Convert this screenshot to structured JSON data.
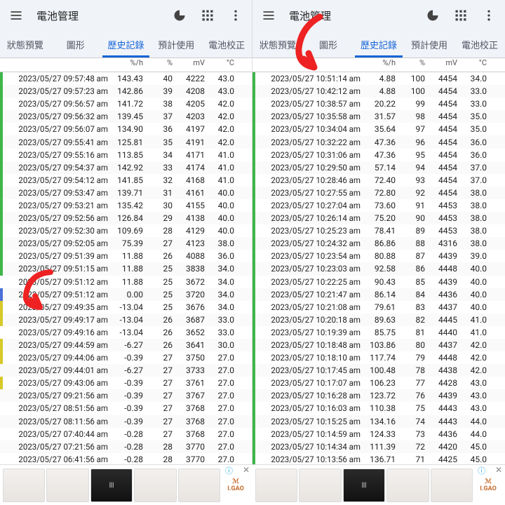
{
  "appbar": {
    "title": "電池管理"
  },
  "tabs": {
    "items": [
      "狀態預覽",
      "圖形",
      "歷史記錄",
      "預計使用",
      "電池校正"
    ],
    "active_index": 2
  },
  "headers": {
    "rate": "%/h",
    "pct": "%",
    "mv": "mV",
    "temp": "°C"
  },
  "left_rows": [
    {
      "c": "g",
      "dt": "2023/05/27 09:57:48 am",
      "rate": "143.43",
      "pct": "40",
      "mv": "4222",
      "temp": "43.0"
    },
    {
      "c": "g",
      "dt": "2023/05/27 09:57:23 am",
      "rate": "142.86",
      "pct": "39",
      "mv": "4208",
      "temp": "43.0"
    },
    {
      "c": "g",
      "dt": "2023/05/27 09:56:57 am",
      "rate": "141.72",
      "pct": "38",
      "mv": "4205",
      "temp": "42.0"
    },
    {
      "c": "g",
      "dt": "2023/05/27 09:56:32 am",
      "rate": "139.45",
      "pct": "37",
      "mv": "4203",
      "temp": "42.0"
    },
    {
      "c": "g",
      "dt": "2023/05/27 09:56:07 am",
      "rate": "134.90",
      "pct": "36",
      "mv": "4197",
      "temp": "42.0"
    },
    {
      "c": "g",
      "dt": "2023/05/27 09:55:41 am",
      "rate": "125.81",
      "pct": "35",
      "mv": "4191",
      "temp": "42.0"
    },
    {
      "c": "g",
      "dt": "2023/05/27 09:55:16 am",
      "rate": "113.85",
      "pct": "34",
      "mv": "4171",
      "temp": "41.0"
    },
    {
      "c": "g",
      "dt": "2023/05/27 09:54:37 am",
      "rate": "142.92",
      "pct": "33",
      "mv": "4174",
      "temp": "41.0"
    },
    {
      "c": "g",
      "dt": "2023/05/27 09:54:12 am",
      "rate": "141.85",
      "pct": "32",
      "mv": "4168",
      "temp": "41.0"
    },
    {
      "c": "g",
      "dt": "2023/05/27 09:53:47 am",
      "rate": "139.71",
      "pct": "31",
      "mv": "4161",
      "temp": "40.0"
    },
    {
      "c": "g",
      "dt": "2023/05/27 09:53:21 am",
      "rate": "135.42",
      "pct": "30",
      "mv": "4155",
      "temp": "40.0"
    },
    {
      "c": "g",
      "dt": "2023/05/27 09:52:56 am",
      "rate": "126.84",
      "pct": "29",
      "mv": "4138",
      "temp": "40.0"
    },
    {
      "c": "g",
      "dt": "2023/05/27 09:52:30 am",
      "rate": "109.69",
      "pct": "28",
      "mv": "4129",
      "temp": "40.0"
    },
    {
      "c": "g",
      "dt": "2023/05/27 09:52:05 am",
      "rate": "75.39",
      "pct": "27",
      "mv": "4123",
      "temp": "38.0"
    },
    {
      "c": "g",
      "dt": "2023/05/27 09:51:39 am",
      "rate": "11.88",
      "pct": "26",
      "mv": "4088",
      "temp": "36.0"
    },
    {
      "c": "g",
      "dt": "2023/05/27 09:51:15 am",
      "rate": "11.88",
      "pct": "25",
      "mv": "3838",
      "temp": "34.0"
    },
    {
      "c": "",
      "dt": "2023/05/27 09:51:12 am",
      "rate": "11.88",
      "pct": "25",
      "mv": "3672",
      "temp": "34.0"
    },
    {
      "c": "b",
      "dt": "2023/05/27 09:51:12 am",
      "rate": "0.00",
      "pct": "25",
      "mv": "3720",
      "temp": "34.0"
    },
    {
      "c": "y",
      "dt": "2023/05/27 09:49:35 am",
      "rate": "-13.04",
      "pct": "25",
      "mv": "3676",
      "temp": "34.0"
    },
    {
      "c": "y",
      "dt": "2023/05/27 09:49:17 am",
      "rate": "-13.04",
      "pct": "26",
      "mv": "3687",
      "temp": "33.0"
    },
    {
      "c": "",
      "dt": "2023/05/27 09:49:16 am",
      "rate": "-13.04",
      "pct": "26",
      "mv": "3652",
      "temp": "33.0"
    },
    {
      "c": "y",
      "dt": "2023/05/27 09:44:59 am",
      "rate": "-6.27",
      "pct": "26",
      "mv": "3641",
      "temp": "30.0"
    },
    {
      "c": "y",
      "dt": "2023/05/27 09:44:06 am",
      "rate": "-0.39",
      "pct": "27",
      "mv": "3750",
      "temp": "27.0"
    },
    {
      "c": "",
      "dt": "2023/05/27 09:44:01 am",
      "rate": "-6.27",
      "pct": "27",
      "mv": "3733",
      "temp": "27.0"
    },
    {
      "c": "y",
      "dt": "2023/05/27 09:43:06 am",
      "rate": "-0.39",
      "pct": "27",
      "mv": "3761",
      "temp": "27.0"
    },
    {
      "c": "",
      "dt": "2023/05/27 09:21:56 am",
      "rate": "-0.39",
      "pct": "27",
      "mv": "3767",
      "temp": "27.0"
    },
    {
      "c": "",
      "dt": "2023/05/27 08:51:56 am",
      "rate": "-0.39",
      "pct": "27",
      "mv": "3768",
      "temp": "27.0"
    },
    {
      "c": "",
      "dt": "2023/05/27 08:11:56 am",
      "rate": "-0.39",
      "pct": "27",
      "mv": "3768",
      "temp": "27.0"
    },
    {
      "c": "",
      "dt": "2023/05/27 07:40:44 am",
      "rate": "-0.28",
      "pct": "27",
      "mv": "3768",
      "temp": "27.0"
    },
    {
      "c": "",
      "dt": "2023/05/27 07:21:56 am",
      "rate": "-0.28",
      "pct": "28",
      "mv": "3770",
      "temp": "27.0"
    },
    {
      "c": "",
      "dt": "2023/05/27 06:41:56 am",
      "rate": "-0.28",
      "pct": "28",
      "mv": "3770",
      "temp": "27.0"
    }
  ],
  "right_rows": [
    {
      "c": "g",
      "dt": "2023/05/27 10:51:14 am",
      "rate": "4.88",
      "pct": "100",
      "mv": "4454",
      "temp": "34.0"
    },
    {
      "c": "g",
      "dt": "2023/05/27 10:42:12 am",
      "rate": "4.88",
      "pct": "100",
      "mv": "4454",
      "temp": "33.0"
    },
    {
      "c": "g",
      "dt": "2023/05/27 10:38:57 am",
      "rate": "20.22",
      "pct": "99",
      "mv": "4454",
      "temp": "33.0"
    },
    {
      "c": "g",
      "dt": "2023/05/27 10:35:58 am",
      "rate": "31.57",
      "pct": "98",
      "mv": "4454",
      "temp": "35.0"
    },
    {
      "c": "g",
      "dt": "2023/05/27 10:34:04 am",
      "rate": "35.64",
      "pct": "97",
      "mv": "4454",
      "temp": "35.0"
    },
    {
      "c": "g",
      "dt": "2023/05/27 10:32:22 am",
      "rate": "47.36",
      "pct": "96",
      "mv": "4454",
      "temp": "36.0"
    },
    {
      "c": "g",
      "dt": "2023/05/27 10:31:06 am",
      "rate": "47.36",
      "pct": "95",
      "mv": "4454",
      "temp": "36.0"
    },
    {
      "c": "g",
      "dt": "2023/05/27 10:29:50 am",
      "rate": "57.14",
      "pct": "94",
      "mv": "4454",
      "temp": "37.0"
    },
    {
      "c": "g",
      "dt": "2023/05/27 10:28:46 am",
      "rate": "72.40",
      "pct": "93",
      "mv": "4454",
      "temp": "37.0"
    },
    {
      "c": "g",
      "dt": "2023/05/27 10:27:55 am",
      "rate": "72.80",
      "pct": "92",
      "mv": "4454",
      "temp": "38.0"
    },
    {
      "c": "g",
      "dt": "2023/05/27 10:27:04 am",
      "rate": "73.60",
      "pct": "91",
      "mv": "4453",
      "temp": "38.0"
    },
    {
      "c": "g",
      "dt": "2023/05/27 10:26:14 am",
      "rate": "75.20",
      "pct": "90",
      "mv": "4453",
      "temp": "38.0"
    },
    {
      "c": "g",
      "dt": "2023/05/27 10:25:23 am",
      "rate": "78.41",
      "pct": "89",
      "mv": "4453",
      "temp": "38.0"
    },
    {
      "c": "g",
      "dt": "2023/05/27 10:24:32 am",
      "rate": "86.86",
      "pct": "88",
      "mv": "4316",
      "temp": "38.0"
    },
    {
      "c": "g",
      "dt": "2023/05/27 10:23:54 am",
      "rate": "80.88",
      "pct": "87",
      "mv": "4439",
      "temp": "39.0"
    },
    {
      "c": "g",
      "dt": "2023/05/27 10:23:03 am",
      "rate": "92.58",
      "pct": "86",
      "mv": "4448",
      "temp": "40.0"
    },
    {
      "c": "g",
      "dt": "2023/05/27 10:22:25 am",
      "rate": "90.43",
      "pct": "85",
      "mv": "4439",
      "temp": "40.0"
    },
    {
      "c": "g",
      "dt": "2023/05/27 10:21:47 am",
      "rate": "86.14",
      "pct": "84",
      "mv": "4436",
      "temp": "40.0"
    },
    {
      "c": "g",
      "dt": "2023/05/27 10:21:08 am",
      "rate": "79.61",
      "pct": "83",
      "mv": "4437",
      "temp": "40.0"
    },
    {
      "c": "g",
      "dt": "2023/05/27 10:20:18 am",
      "rate": "89.63",
      "pct": "82",
      "mv": "4445",
      "temp": "41.0"
    },
    {
      "c": "g",
      "dt": "2023/05/27 10:19:39 am",
      "rate": "85.75",
      "pct": "81",
      "mv": "4440",
      "temp": "41.0"
    },
    {
      "c": "g",
      "dt": "2023/05/27 10:18:48 am",
      "rate": "103.86",
      "pct": "80",
      "mv": "4437",
      "temp": "42.0"
    },
    {
      "c": "g",
      "dt": "2023/05/27 10:18:10 am",
      "rate": "117.74",
      "pct": "79",
      "mv": "4448",
      "temp": "42.0"
    },
    {
      "c": "g",
      "dt": "2023/05/27 10:17:45 am",
      "rate": "100.48",
      "pct": "78",
      "mv": "4438",
      "temp": "42.0"
    },
    {
      "c": "g",
      "dt": "2023/05/27 10:17:07 am",
      "rate": "106.23",
      "pct": "77",
      "mv": "4428",
      "temp": "43.0"
    },
    {
      "c": "g",
      "dt": "2023/05/27 10:16:28 am",
      "rate": "123.72",
      "pct": "76",
      "mv": "4439",
      "temp": "43.0"
    },
    {
      "c": "g",
      "dt": "2023/05/27 10:16:03 am",
      "rate": "110.38",
      "pct": "75",
      "mv": "4443",
      "temp": "43.0"
    },
    {
      "c": "g",
      "dt": "2023/05/27 10:15:25 am",
      "rate": "134.16",
      "pct": "74",
      "mv": "4443",
      "temp": "44.0"
    },
    {
      "c": "g",
      "dt": "2023/05/27 10:14:59 am",
      "rate": "124.33",
      "pct": "73",
      "mv": "4436",
      "temp": "44.0"
    },
    {
      "c": "g",
      "dt": "2023/05/27 10:14:34 am",
      "rate": "111.39",
      "pct": "72",
      "mv": "4420",
      "temp": "45.0"
    },
    {
      "c": "g",
      "dt": "2023/05/27 10:13:56 am",
      "rate": "136.71",
      "pct": "71",
      "mv": "4425",
      "temp": "45.0"
    }
  ],
  "ad": {
    "brand": "I.GAO",
    "info_glyph": "ⓘ",
    "close_glyph": "✕"
  }
}
